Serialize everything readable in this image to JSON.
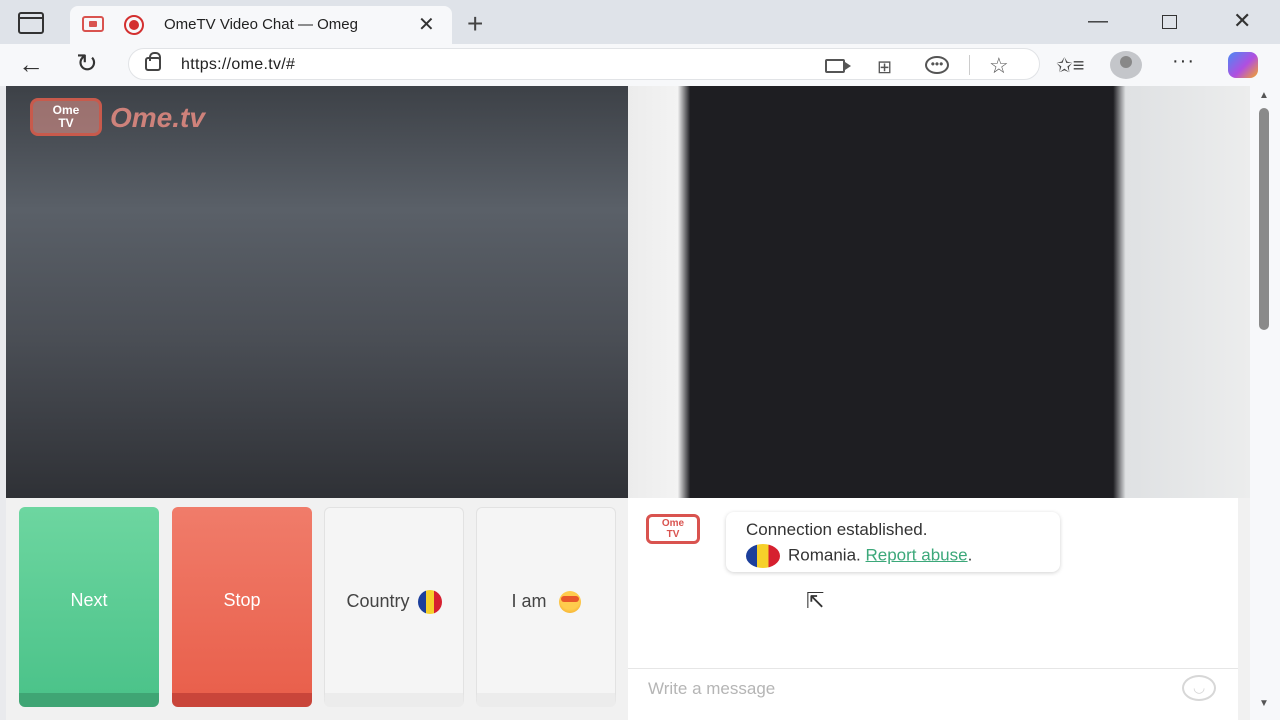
{
  "browser": {
    "tab_title": "OmeTV Video Chat — Omeg",
    "tab_close": "✕",
    "new_tab": "+",
    "url": "https://ome.tv/#",
    "back": "←",
    "refresh": "↻",
    "menu": "···",
    "grid": "⊞",
    "star": "☆",
    "favorites": "✩≡",
    "win_minimize": "—",
    "win_close": "✕"
  },
  "logo": {
    "badge_text": "Ome\nTV",
    "wordmark": "Ome.tv"
  },
  "controls": {
    "next_label": "Next",
    "stop_label": "Stop",
    "country_label": "Country",
    "iam_label": "I am"
  },
  "chat": {
    "badge_text": "Ome\nTV",
    "message_line1": "Connection established.",
    "message_country": "Romania.",
    "report_link": "Report abuse",
    "message_end": ".",
    "input_placeholder": "Write a message"
  },
  "colors": {
    "next": "#4cc38a",
    "stop": "#e9604c",
    "link": "#3ca87a"
  }
}
